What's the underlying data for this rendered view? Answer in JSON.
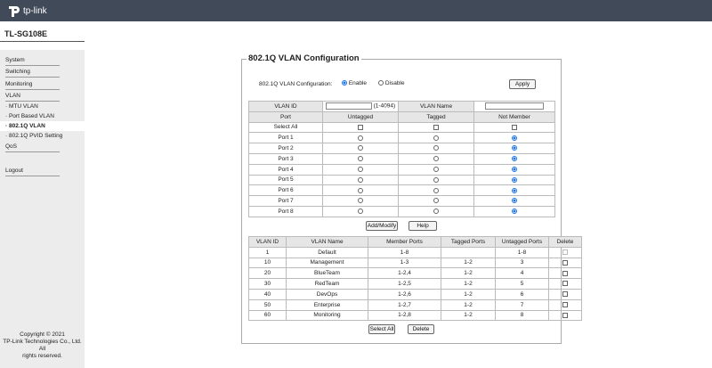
{
  "header": {
    "brand": "tp-link",
    "model": "TL-SG108E",
    "bar_color": "#414a59"
  },
  "sidebar": {
    "items": [
      {
        "label": "System"
      },
      {
        "label": "Switching"
      },
      {
        "label": "Monitoring"
      },
      {
        "label": "VLAN"
      },
      {
        "label": "· MTU VLAN"
      },
      {
        "label": "· Port Based VLAN"
      },
      {
        "label": "· 802.1Q VLAN"
      },
      {
        "label": "· 802.1Q PVID Setting"
      },
      {
        "label": "QoS"
      },
      {
        "label": "Logout"
      }
    ],
    "active": "· 802.1Q VLAN",
    "copyright": [
      "Copyright © 2021",
      "TP-Link Technologies Co., Ltd. All",
      "rights reserved."
    ]
  },
  "config": {
    "title": "802.1Q VLAN Configuration",
    "label": "802.1Q VLAN Configuration:",
    "enable": "Enable",
    "disable": "Disable",
    "enabled": true,
    "apply": "Apply"
  },
  "membership": {
    "vlan_id_label": "VLAN ID",
    "vlan_id_value": "",
    "vlan_id_hint": "(1-4094)",
    "vlan_name_label": "VLAN Name",
    "vlan_name_value": "",
    "headers": [
      "Port",
      "Untagged",
      "Tagged",
      "Not Member"
    ],
    "select_all": "Select All",
    "ports": [
      {
        "port": "Port 1",
        "choice": "Not Member"
      },
      {
        "port": "Port 2",
        "choice": "Not Member"
      },
      {
        "port": "Port 3",
        "choice": "Not Member"
      },
      {
        "port": "Port 4",
        "choice": "Not Member"
      },
      {
        "port": "Port 5",
        "choice": "Not Member"
      },
      {
        "port": "Port 6",
        "choice": "Not Member"
      },
      {
        "port": "Port 7",
        "choice": "Not Member"
      },
      {
        "port": "Port 8",
        "choice": "Not Member"
      }
    ],
    "add_modify": "Add/Modify",
    "help": "Help"
  },
  "vlan_table": {
    "headers": [
      "VLAN ID",
      "VLAN Name",
      "Member Ports",
      "Tagged Ports",
      "Untagged Ports",
      "Delete"
    ],
    "rows": [
      {
        "id": "1",
        "name": "Default",
        "member": "1-8",
        "tagged": "",
        "untagged": "1-8",
        "deletable": false
      },
      {
        "id": "10",
        "name": "Management",
        "member": "1-3",
        "tagged": "1-2",
        "untagged": "3",
        "deletable": true
      },
      {
        "id": "20",
        "name": "BlueTeam",
        "member": "1-2,4",
        "tagged": "1-2",
        "untagged": "4",
        "deletable": true
      },
      {
        "id": "30",
        "name": "RedTeam",
        "member": "1-2,5",
        "tagged": "1-2",
        "untagged": "5",
        "deletable": true
      },
      {
        "id": "40",
        "name": "DevOps",
        "member": "1-2,6",
        "tagged": "1-2",
        "untagged": "6",
        "deletable": true
      },
      {
        "id": "50",
        "name": "Enterprise",
        "member": "1-2,7",
        "tagged": "1-2",
        "untagged": "7",
        "deletable": true
      },
      {
        "id": "60",
        "name": "Monitoring",
        "member": "1-2,8",
        "tagged": "1-2",
        "untagged": "8",
        "deletable": true
      }
    ],
    "select_all": "Select All",
    "delete": "Delete"
  }
}
